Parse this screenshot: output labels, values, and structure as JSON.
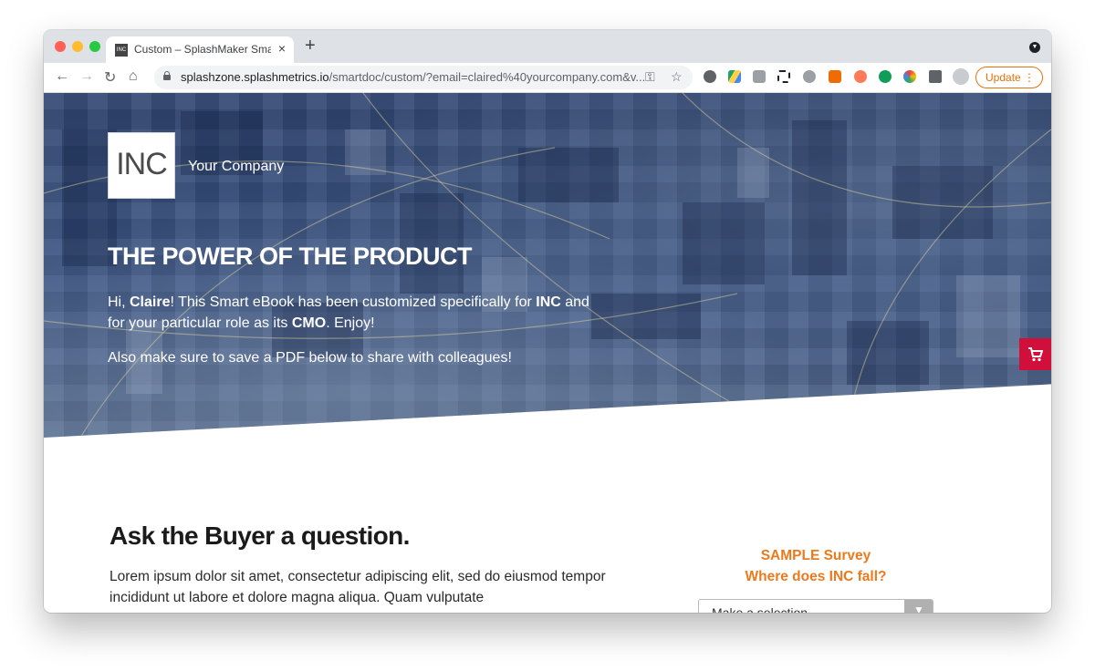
{
  "browser": {
    "tab_title": "Custom – SplashMaker SmartD",
    "tab_favicon": "INC",
    "url_host": "splashzone.splashmetrics.io",
    "url_path": "/smartdoc/custom/?email=claired%40yourcompany.com&v...",
    "update_label": "Update"
  },
  "hero": {
    "logo_text": "INC",
    "company_name": "Your Company",
    "title": "THE POWER OF THE PRODUCT",
    "greeting": {
      "hi": "Hi, ",
      "name": "Claire",
      "mid": "! This Smart eBook has been customized specifically for ",
      "company": "INC",
      "mid2": " and for your particular role as its ",
      "role": "CMO",
      "end": ". Enjoy!"
    },
    "save_note": "Also make sure to save a PDF below to share with colleagues!"
  },
  "section": {
    "title": "Ask the Buyer a question.",
    "body": "Lorem ipsum dolor sit amet, consectetur adipiscing elit, sed do eiusmod tempor incididunt ut labore et dolore magna aliqua. Quam vulputate"
  },
  "survey": {
    "title_line1": "SAMPLE Survey",
    "title_line2": "Where does INC fall?",
    "select_value": "Make a selection"
  },
  "colors": {
    "accent_orange": "#ec7a1c",
    "cart_red": "#d0103a",
    "hero_blue": "#3c5583"
  }
}
